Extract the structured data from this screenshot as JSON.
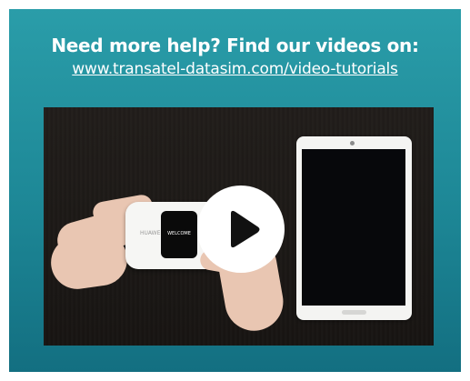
{
  "help": {
    "heading": "Need more help? Find our videos on:",
    "link": "www.transatel-datasim.com/video-tutorials"
  },
  "video": {
    "router_brand": "HUAWEI",
    "router_screen_text": "WELCOME",
    "play_icon": "play-icon"
  },
  "colors": {
    "card_top": "#2a9da9",
    "card_bottom": "#136f81",
    "text": "#ffffff"
  }
}
